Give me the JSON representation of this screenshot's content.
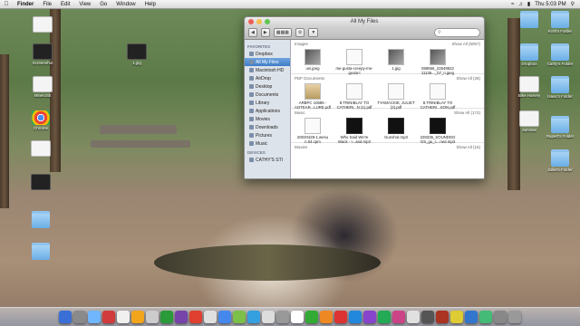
{
  "menubar": {
    "app": "Finder",
    "menus": [
      "File",
      "Edit",
      "View",
      "Go",
      "Window",
      "Help"
    ],
    "clock": "Thu 5:03 PM"
  },
  "desktop_left": [
    {
      "label": "",
      "kind": "doc"
    },
    {
      "label": "Screenshot",
      "kind": "dark"
    },
    {
      "label": "Minecraft",
      "kind": "doc"
    },
    {
      "label": "Chrome",
      "kind": "chrome"
    },
    {
      "label": "",
      "kind": "doc"
    },
    {
      "label": "",
      "kind": "dark"
    },
    {
      "label": "",
      "kind": "folder"
    },
    {
      "label": "",
      "kind": "folder"
    }
  ],
  "desktop_middle": {
    "label": "1.jpg"
  },
  "desktop_right": [
    {
      "label": "",
      "kind": "folder"
    },
    {
      "label": "Kohl's Folder",
      "kind": "folder"
    },
    {
      "label": "Dropbox",
      "kind": "folder"
    },
    {
      "label": "Cathy's Folder",
      "kind": "folder"
    },
    {
      "label": "Bike Harvey",
      "kind": "doc"
    },
    {
      "label": "Isaac's Folder",
      "kind": "folder"
    },
    {
      "label": "survival",
      "kind": "doc"
    },
    {
      "label": "Rupert's Folder",
      "kind": "folder"
    },
    {
      "label": "Juliet's Folder",
      "kind": "folder"
    }
  ],
  "finder": {
    "title": "All My Files",
    "search_placeholder": "",
    "sidebar": {
      "favorites_head": "FAVORITES",
      "items": [
        "Dropbox",
        "All My Files",
        "Macintosh HD",
        "AirDrop",
        "Desktop",
        "Documents",
        "Library",
        "Applications",
        "Movies",
        "Downloads",
        "Pictures",
        "Music"
      ],
      "devices_head": "DEVICES",
      "devices": [
        "CATHY'S STI"
      ]
    },
    "sections": [
      {
        "title": "Images",
        "show_all": "Show All (5057)",
        "files": [
          {
            "name": "uni.jpeg",
            "kind": "img"
          },
          {
            "name": "me-gusta-creepy-me-gusta-l",
            "kind": "pdf"
          },
          {
            "name": "1.jpg",
            "kind": "img"
          },
          {
            "name": "558556_23549522 11136..._b7_n.jpeg",
            "kind": "img"
          }
        ]
      },
      {
        "title": "PDF Documents",
        "show_all": "Show All (28)",
        "files": [
          {
            "name": "ARBPC 10685 - AOTEAR...LURE.pdf",
            "kind": "pdf"
          },
          {
            "name": "8.TRINIBLAY TO CATHERI...N (1).pdf",
            "kind": "pdf"
          },
          {
            "name": "TYAMACKIE, JULIET (2).pdf",
            "kind": "pdf"
          },
          {
            "name": "8.TRINIBLAY TO CATHERI...SON.pdf",
            "kind": "pdf"
          }
        ]
      },
      {
        "title": "Music",
        "show_all": "Show All (172)",
        "files": [
          {
            "name": "20020428-1.wesu n.04.cpm",
            "kind": "pdf"
          },
          {
            "name": "Who Said We're Wack - I...and.mp3",
            "kind": "mp3"
          },
          {
            "name": "Gunshot.mp3",
            "kind": "mp3"
          },
          {
            "name": "228335_SOUNDDO GS_gu_c...ried.mp3",
            "kind": "mp3"
          }
        ]
      },
      {
        "title": "Movies",
        "show_all": "Show All (16)",
        "files": []
      }
    ]
  },
  "dock": {
    "colors": [
      "#3a6fd8",
      "#8a8a8a",
      "#6fb6ff",
      "#d23b3b",
      "#f0f0f0",
      "#f2a51a",
      "#cccccc",
      "#2a9a3a",
      "#7744aa",
      "#e04030",
      "#e0e0e0",
      "#4488ee",
      "#7cc04a",
      "#35a0e0",
      "#dddddd",
      "#999999",
      "#ffffff",
      "#33aa33",
      "#ee8822",
      "#dd3333",
      "#2288dd",
      "#8844cc",
      "#22aa55",
      "#cc4488",
      "#e0e0e0",
      "#555555",
      "#aa3322",
      "#ddcc33",
      "#3377cc",
      "#44bb77",
      "#888888",
      "#999999"
    ]
  }
}
